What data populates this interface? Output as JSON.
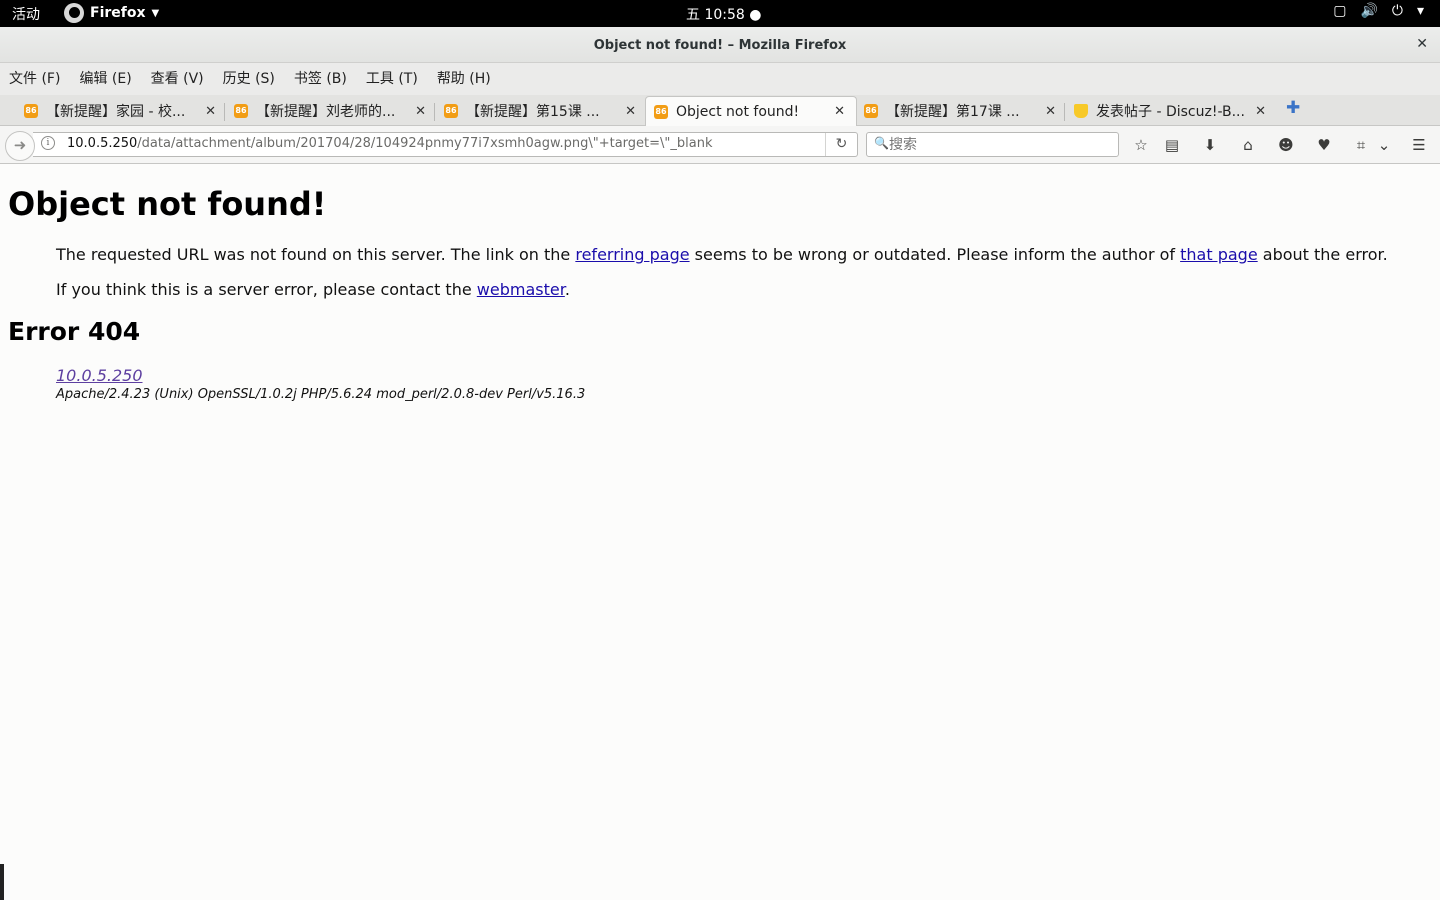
{
  "topbar": {
    "activities": "活动",
    "app_name": "Firefox",
    "clock": "五 10:58 ●",
    "icons": [
      "screen-icon",
      "volume-icon",
      "power-icon",
      "chevron-down-icon"
    ]
  },
  "window": {
    "title": "Object not found! – Mozilla Firefox",
    "close": "✕"
  },
  "menu": [
    "文件 (F)",
    "编辑 (E)",
    "查看 (V)",
    "历史 (S)",
    "书签 (B)",
    "工具 (T)",
    "帮助 (H)"
  ],
  "tabs": [
    {
      "label": "【新提醒】家园 - 校...",
      "favicon": "86"
    },
    {
      "label": "【新提醒】刘老师的...",
      "favicon": "86"
    },
    {
      "label": "【新提醒】第15课 ...",
      "favicon": "86"
    },
    {
      "label": "Object not found!",
      "favicon": "86",
      "active": true
    },
    {
      "label": "【新提醒】第17课 ...",
      "favicon": "86"
    },
    {
      "label": "发表帖子 - Discuz!-B...",
      "favicon": "cup"
    }
  ],
  "tab_close": "✕",
  "new_tab": "✚",
  "navbar": {
    "url_host": "10.0.5.250",
    "url_path": "/data/attachment/album/201704/28/104924pnmy77i7xsmh0agw.png\\\"+target=\\\"_blank",
    "search_placeholder": "搜索",
    "toolbar_icons": [
      "bookmark-star-icon",
      "reading-list-icon",
      "download-icon",
      "home-icon",
      "chat-icon",
      "pocket-icon",
      "screenshot-icon",
      "overflow-chevron-icon",
      "hamburger-menu-icon"
    ]
  },
  "page": {
    "heading": "Object not found!",
    "p1_before": "The requested URL was not found on this server. The link on the ",
    "p1_link1": "referring page",
    "p1_middle": " seems to be wrong or outdated. Please inform the author of ",
    "p1_link2": "that page",
    "p1_after": " about the error.",
    "p2_before": "If you think this is a server error, please contact the ",
    "p2_link": "webmaster",
    "p2_after": ".",
    "error_heading": "Error 404",
    "server_link": "10.0.5.250",
    "server_signature": "Apache/2.4.23 (Unix) OpenSSL/1.0.2j PHP/5.6.24 mod_perl/2.0.8-dev Perl/v5.16.3"
  },
  "colors": {
    "link": "#1a0dab",
    "visited_link": "#5d3fa0",
    "accent": "#3b74c7"
  }
}
